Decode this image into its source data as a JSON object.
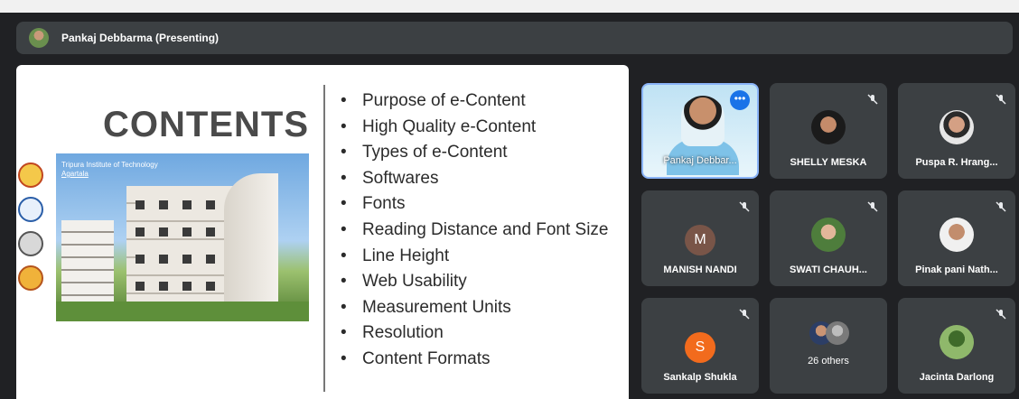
{
  "presenter": {
    "name": "Pankaj Debbarma (Presenting)"
  },
  "slide": {
    "title": "CONTENTS",
    "photo_caption": {
      "line1": "Tripura Institute of Technology",
      "line2": "Agartala"
    },
    "bullets": [
      "Purpose of e-Content",
      "High Quality e-Content",
      "Types of e-Content",
      "Softwares",
      "Fonts",
      "Reading Distance and Font Size",
      "Line Height",
      "Web Usability",
      "Measurement Units",
      "Resolution",
      "Content Formats"
    ]
  },
  "participants": [
    {
      "name": "Pankaj Debbar...",
      "type": "video"
    },
    {
      "name": "SHELLY MESKA",
      "type": "photo",
      "muted": true
    },
    {
      "name": "Puspa R. Hrang...",
      "type": "photo",
      "muted": true
    },
    {
      "name": "MANISH NANDI",
      "type": "letter",
      "letter": "M",
      "color": "#795548",
      "muted": true
    },
    {
      "name": "SWATI CHAUH...",
      "type": "photo",
      "muted": true
    },
    {
      "name": "Pinak pani Nath...",
      "type": "photo",
      "muted": true
    },
    {
      "name": "Sankalp Shukla",
      "type": "letter",
      "letter": "S",
      "color": "#f26b1d",
      "muted": true
    },
    {
      "name": "26 others",
      "type": "group"
    },
    {
      "name": "Jacinta Darlong",
      "type": "photo",
      "muted": true
    }
  ],
  "colors": {
    "meet_bg": "#202124",
    "tile_bg": "#3c4043",
    "accent": "#1a73e8"
  }
}
